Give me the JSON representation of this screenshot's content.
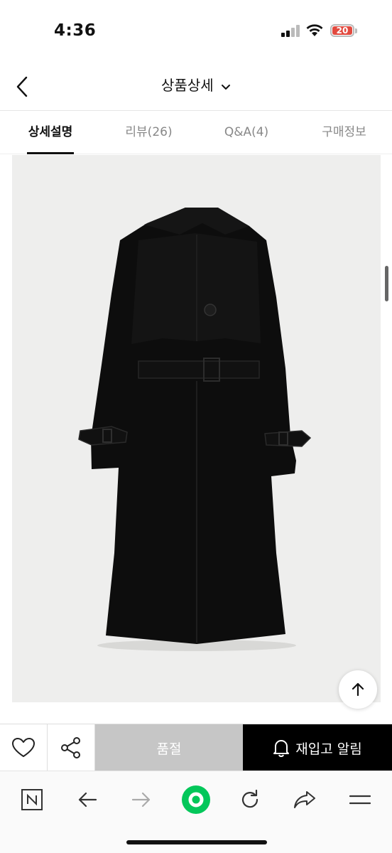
{
  "status_bar": {
    "time": "4:36",
    "battery_level": "20",
    "icons": [
      "signal-icon",
      "wifi-icon",
      "battery-icon"
    ]
  },
  "header": {
    "title": "상품상세",
    "icons": [
      "back-arrow-icon",
      "chevron-down-icon"
    ]
  },
  "tabs": [
    {
      "label": "상세설명",
      "active": true
    },
    {
      "label": "리뷰(26)",
      "active": false
    },
    {
      "label": "Q&A(4)",
      "active": false
    },
    {
      "label": "구매정보",
      "active": false
    }
  ],
  "product": {
    "image_icon": "trench-coat-back-photo"
  },
  "scroll_top_icon": "arrow-up-icon",
  "actions": {
    "like_icon": "heart-icon",
    "share_icon": "share-icon",
    "soldout_label": "품절",
    "restock_label": "재입고 알림",
    "restock_icon": "bell-icon"
  },
  "browser_toolbar": {
    "icons": [
      "naver-icon",
      "back-icon",
      "forward-icon",
      "green-home-icon",
      "refresh-icon",
      "share-arrow-icon",
      "menu-icon"
    ]
  },
  "colors": {
    "accent_black": "#000000",
    "soldout_gray": "#c6c6c6",
    "battery_red": "#e24a3f",
    "naver_green": "#03c75a"
  }
}
